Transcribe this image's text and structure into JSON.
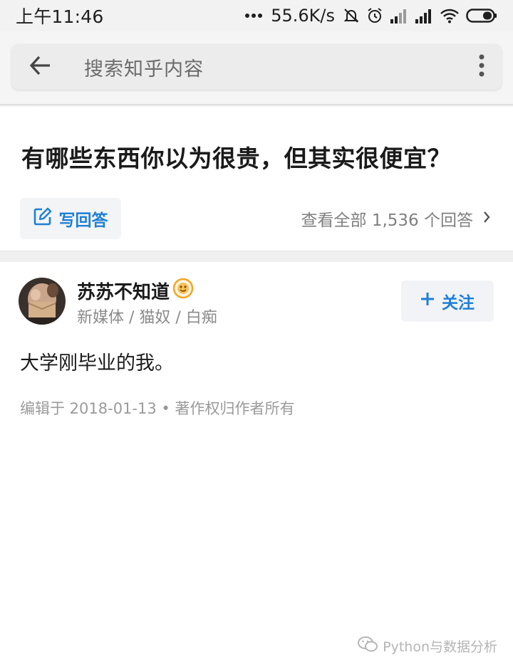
{
  "status_bar": {
    "time": "上午11:46",
    "net_speed": "55.6K/s",
    "icons": [
      "more-dots-icon",
      "mute-bell-icon",
      "alarm-icon",
      "signal-icon",
      "signal-icon",
      "wifi-icon",
      "battery-icon"
    ]
  },
  "search": {
    "placeholder": "搜索知乎内容",
    "back_icon": "arrow-left-icon",
    "more_icon": "more-vertical-icon"
  },
  "question": {
    "title": "有哪些东西你以为很贵，但其实很便宜？",
    "write_answer_label": "写回答",
    "view_all_label": "查看全部 1,536 个回答"
  },
  "answer": {
    "author": {
      "name": "苏苏不知道",
      "bio": "新媒体 / 猫奴 / 白痴"
    },
    "follow_label": "关注",
    "text": "大学刚毕业的我。",
    "meta": "编辑于 2018-01-13 • 著作权归作者所有"
  },
  "watermark": {
    "text": "Python与数据分析"
  },
  "colors": {
    "accent": "#1e7fd6",
    "status_bar_bg": "#f2f2f2",
    "search_bar_bg": "#ececec"
  }
}
